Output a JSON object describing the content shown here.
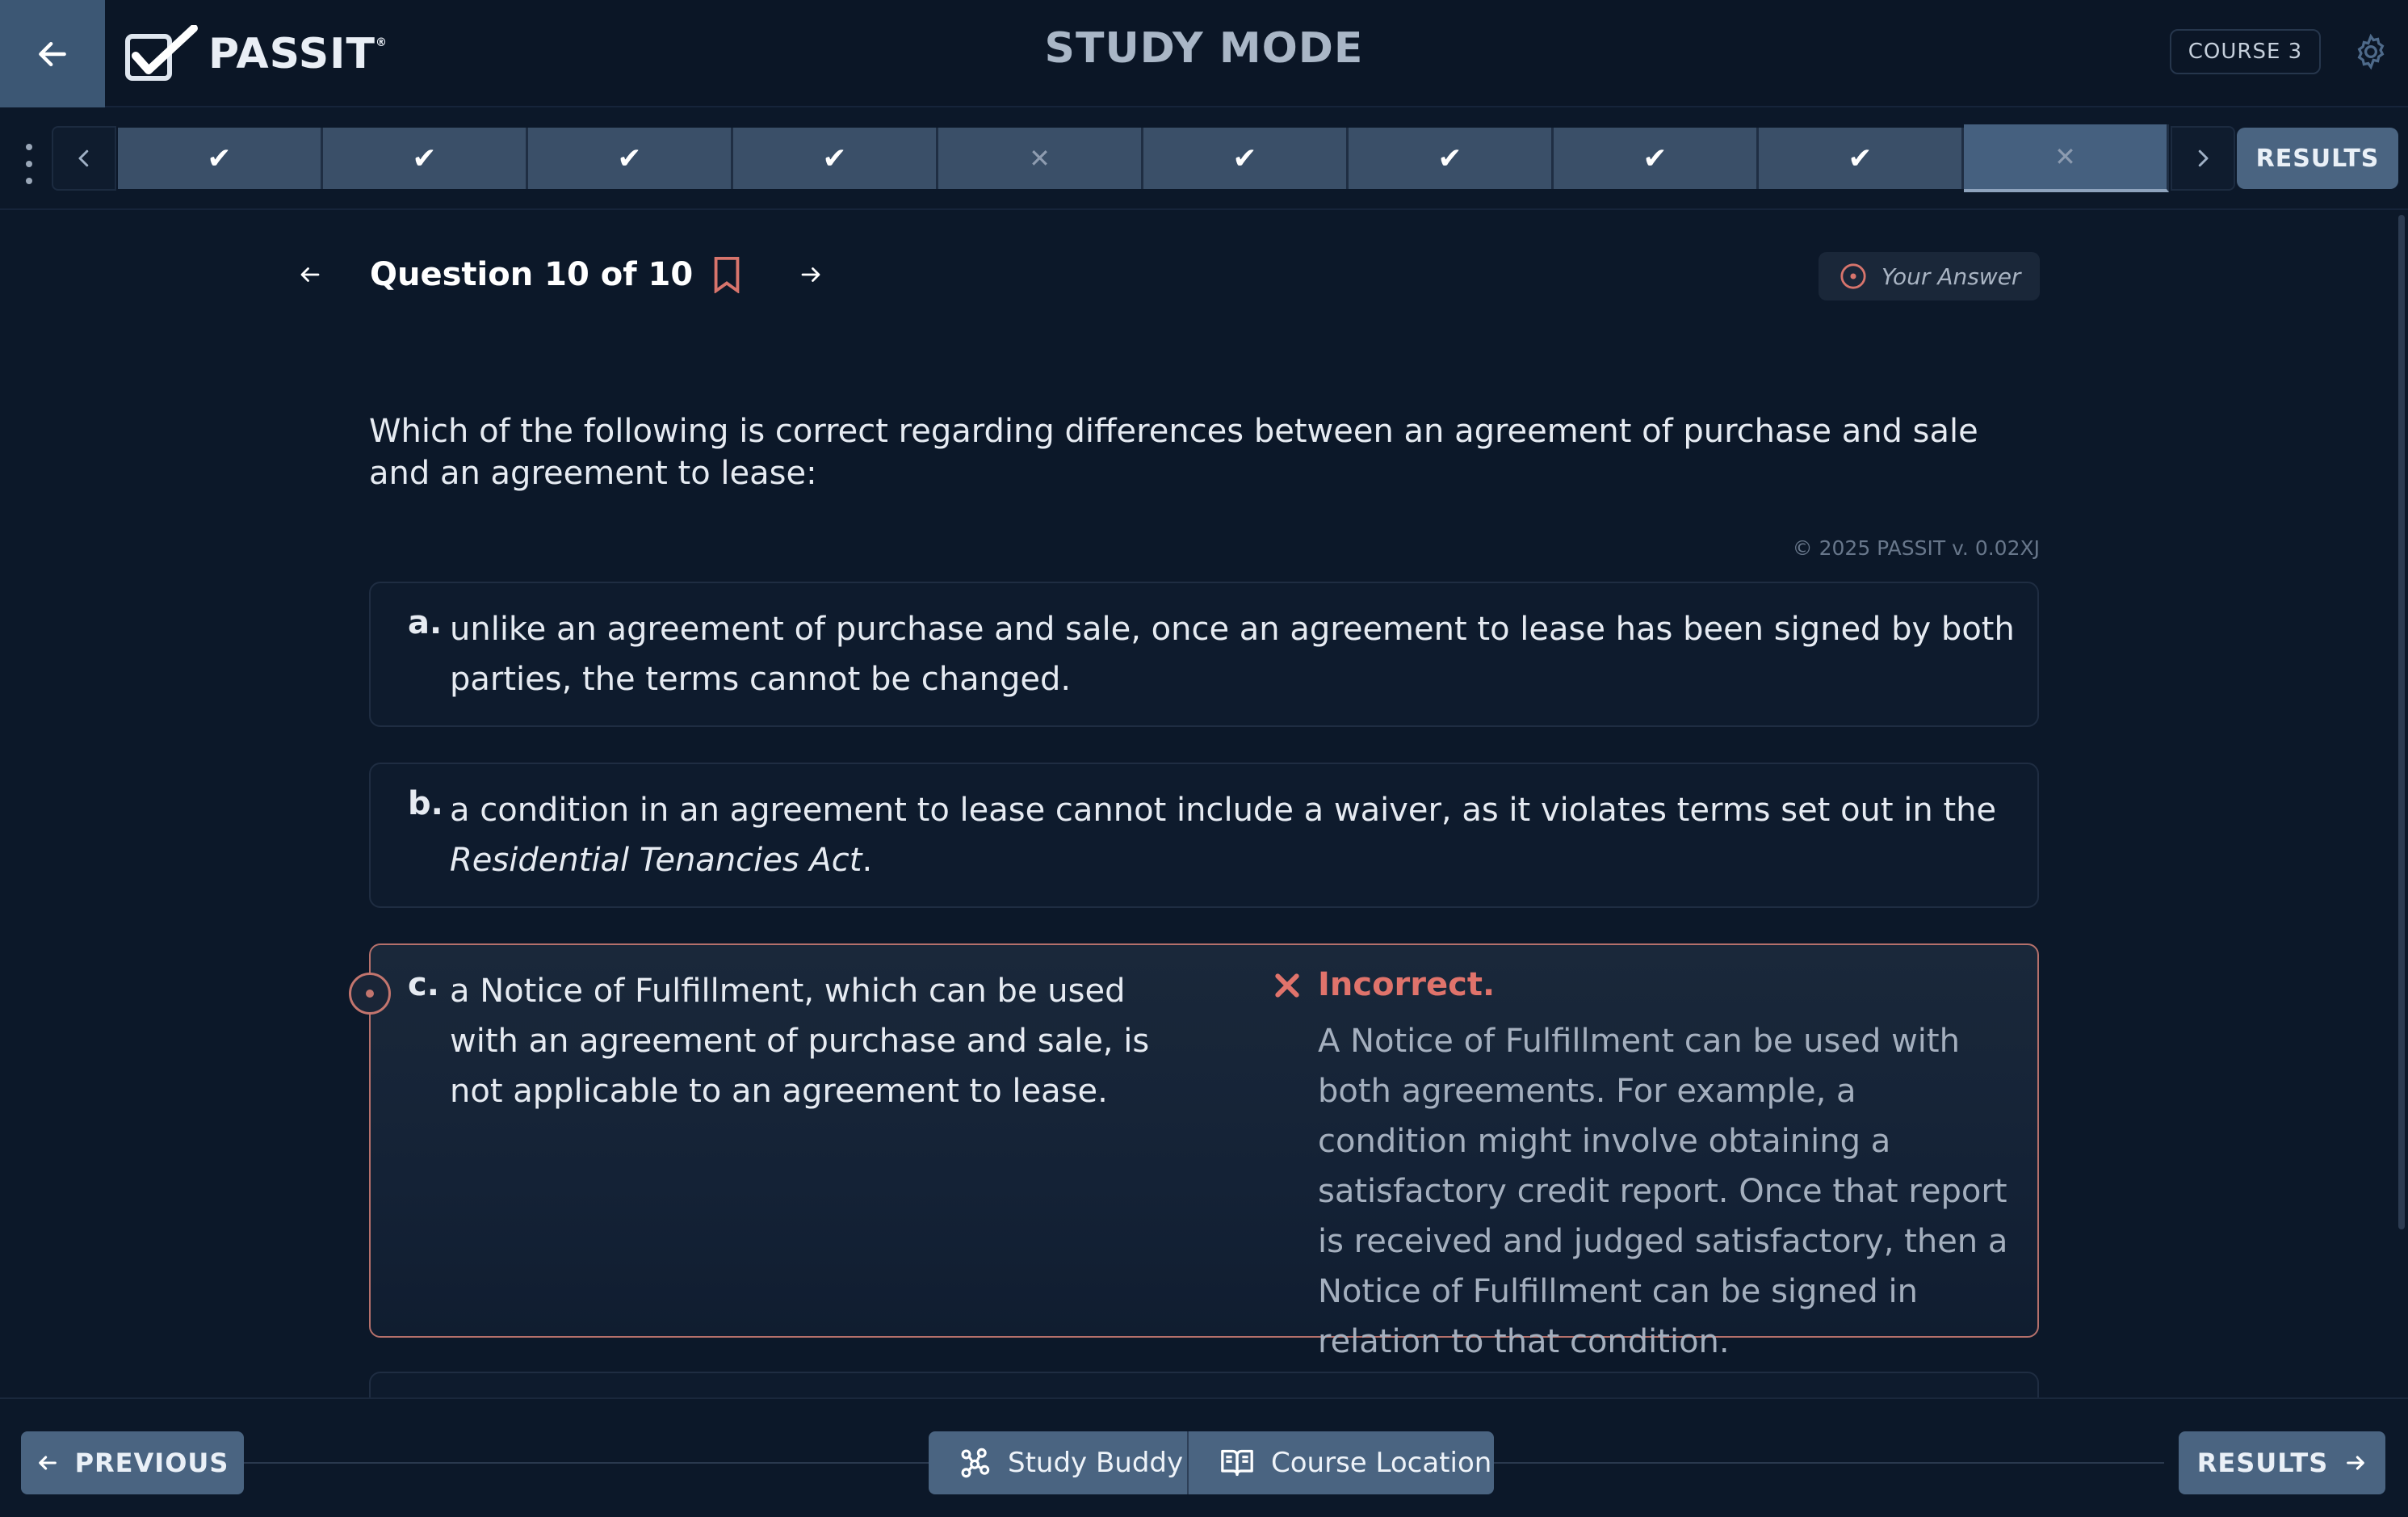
{
  "header": {
    "back_label": "",
    "brand": "PASSIT",
    "brand_mark": "®",
    "mode_title": "STUDY MODE",
    "course": "COURSE 3"
  },
  "progress": {
    "steps": [
      {
        "status": "correct",
        "glyph": "✔"
      },
      {
        "status": "correct",
        "glyph": "✔"
      },
      {
        "status": "correct",
        "glyph": "✔"
      },
      {
        "status": "correct",
        "glyph": "✔"
      },
      {
        "status": "incorrect",
        "glyph": "✕"
      },
      {
        "status": "correct",
        "glyph": "✔"
      },
      {
        "status": "correct",
        "glyph": "✔"
      },
      {
        "status": "correct",
        "glyph": "✔"
      },
      {
        "status": "correct",
        "glyph": "✔"
      },
      {
        "status": "incorrect-current",
        "glyph": "✕"
      }
    ],
    "results_label": "RESULTS"
  },
  "question": {
    "title": "Question 10 of 10",
    "your_answer_label": "Your Answer",
    "stem": "Which of the following is correct regarding differences between an agreement of purchase and sale and an agreement to lease:",
    "copyright": "© 2025 PASSIT v. 0.02XJ",
    "options": [
      {
        "letter": "a.",
        "text": "unlike an agreement of purchase and sale, once an agreement to lease has been signed by both parties, the terms cannot be changed."
      },
      {
        "letter": "b.",
        "text_before": "a condition in an agreement to lease cannot include a waiver, as it violates terms set out in the ",
        "text_italic": "Residential Tenancies Act",
        "text_after": "."
      },
      {
        "letter": "c.",
        "text": "a Notice of Fulfillment, which can be used with an agreement of purchase and sale, is not applicable to an agreement to lease.",
        "selected": true,
        "feedback_title": "Incorrect.",
        "feedback_text": "A Notice of Fulfillment can be used with both agreements. For example, a condition might involve obtaining a satisfactory credit report. Once that report is received and judged satisfactory, then a Notice of Fulfillment can be signed in relation to that condition."
      }
    ]
  },
  "footer": {
    "previous_label": "PREVIOUS",
    "study_buddy_label": "Study Buddy",
    "course_location_label": "Course Location",
    "results_label": "RESULTS"
  },
  "colors": {
    "accent": "#4a6481",
    "incorrect": "#e0736b",
    "background": "#0c1829"
  },
  "icons": [
    "back-arrow-icon",
    "passit-check-logo-icon",
    "settings-gear-icon",
    "kebab-menu-icon",
    "chevron-left-icon",
    "chevron-right-icon",
    "bookmark-icon",
    "radio-target-icon",
    "x-mark-icon",
    "study-buddy-icon",
    "book-icon",
    "arrow-right-icon",
    "arrow-left-icon"
  ]
}
